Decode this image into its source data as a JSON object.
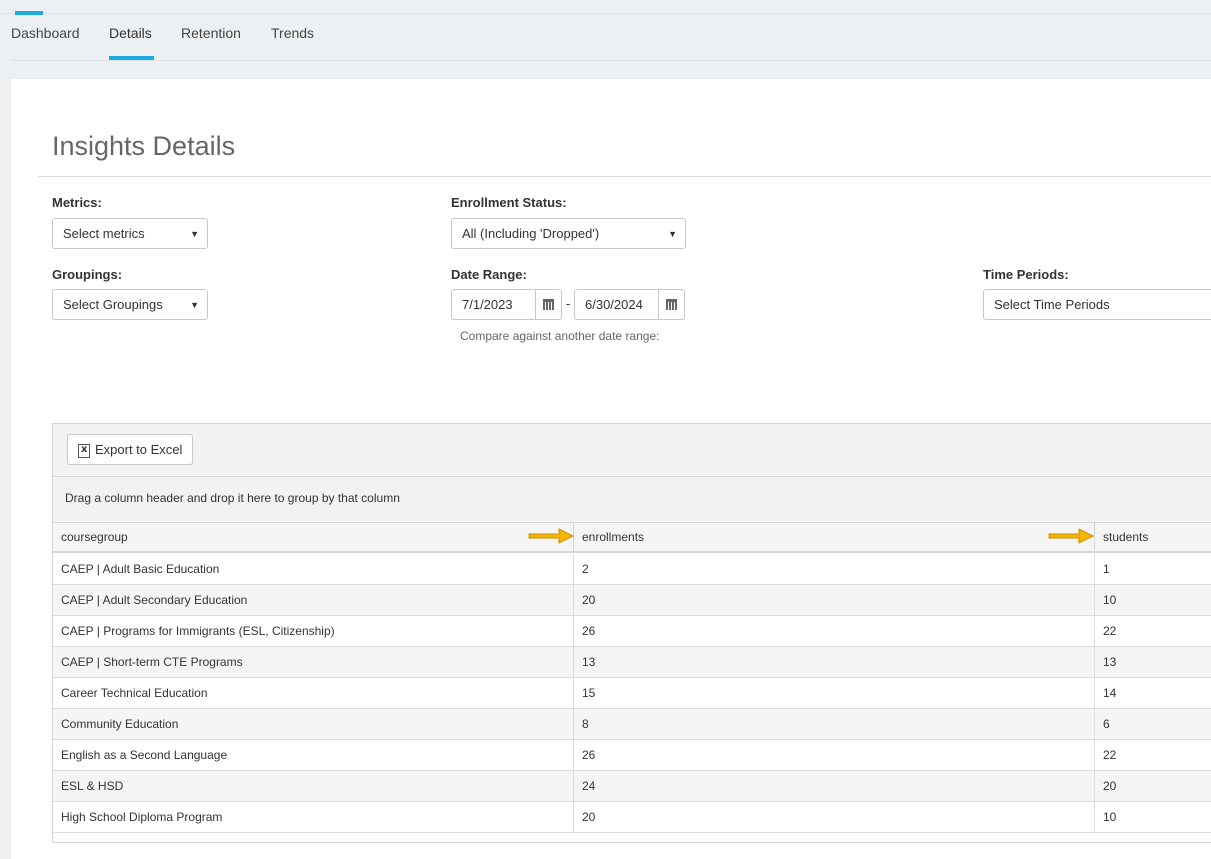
{
  "tabs": [
    {
      "label": "Dashboard"
    },
    {
      "label": "Details"
    },
    {
      "label": "Retention"
    },
    {
      "label": "Trends"
    }
  ],
  "page": {
    "title": "Insights Details"
  },
  "filters": {
    "metrics": {
      "label": "Metrics:",
      "value": "Select metrics"
    },
    "enrollment_status": {
      "label": "Enrollment Status:",
      "value": "All (Including 'Dropped')"
    },
    "groupings": {
      "label": "Groupings:",
      "value": "Select Groupings"
    },
    "date_range": {
      "label": "Date Range:",
      "start": "7/1/2023",
      "separator": "-",
      "end": "6/30/2024",
      "compare_link": "Compare against another date range:"
    },
    "time_periods": {
      "label": "Time Periods:",
      "value": "Select Time Periods"
    }
  },
  "grid": {
    "export_label": "Export to Excel",
    "group_hint": "Drag a column header and drop it here to group by that column",
    "columns": [
      "coursegroup",
      "enrollments",
      "students"
    ],
    "rows": [
      [
        "CAEP | Adult Basic Education",
        "2",
        "1"
      ],
      [
        "CAEP | Adult Secondary Education",
        "20",
        "10"
      ],
      [
        "CAEP | Programs for Immigrants (ESL, Citizenship)",
        "26",
        "22"
      ],
      [
        "CAEP | Short-term CTE Programs",
        "13",
        "13"
      ],
      [
        "Career Technical Education",
        "15",
        "14"
      ],
      [
        "Community Education",
        "8",
        "6"
      ],
      [
        "English as a Second Language",
        "26",
        "22"
      ],
      [
        "ESL & HSD",
        "24",
        "20"
      ],
      [
        "High School Diploma Program",
        "20",
        "10"
      ]
    ]
  },
  "colors": {
    "accent": "#1aabe0",
    "annotation_arrow": "#f5b400"
  }
}
